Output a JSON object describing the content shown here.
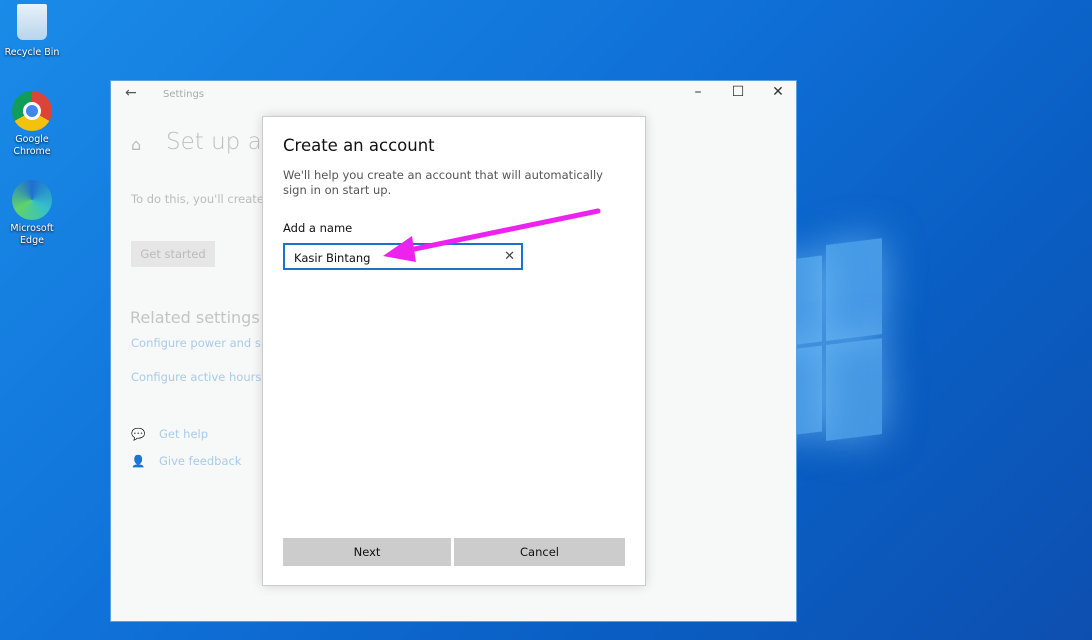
{
  "desktop": {
    "icons": [
      {
        "label": "Recycle Bin",
        "icon": "recycle-bin-icon"
      },
      {
        "label": "Google Chrome",
        "icon": "chrome-icon"
      },
      {
        "label": "Microsoft Edge",
        "icon": "edge-icon"
      }
    ]
  },
  "window": {
    "title": "Settings",
    "page_title": "Set up a k",
    "description": "To do this, you'll create o only app that it can use (",
    "get_started": "Get started",
    "related_heading": "Related settings",
    "links": [
      "Configure power and sle",
      "Configure active hours"
    ],
    "help": [
      "Get help",
      "Give feedback"
    ]
  },
  "dialog": {
    "title": "Create an account",
    "subtitle": "We'll help you create an account that will automatically sign in on start up.",
    "name_label": "Add a name",
    "name_value": "Kasir Bintang",
    "next": "Next",
    "cancel": "Cancel"
  },
  "annotation": {
    "arrow_color": "#ee22ee"
  }
}
